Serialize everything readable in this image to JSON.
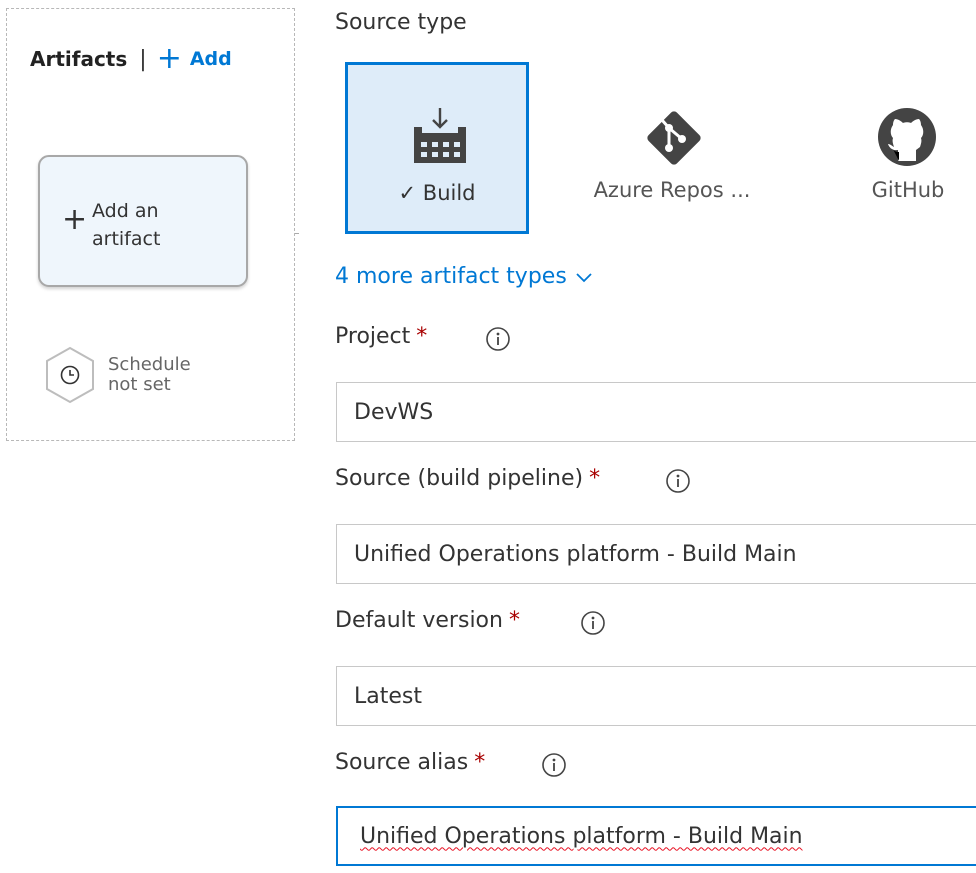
{
  "artifacts": {
    "title": "Artifacts",
    "add_label": "Add",
    "add_card_line1": "Add an",
    "add_card_line2": "artifact",
    "schedule_line1": "Schedule",
    "schedule_line2": "not set"
  },
  "source_type": {
    "label": "Source type",
    "tiles": [
      {
        "label": "Build",
        "icon": "build-icon",
        "selected": true
      },
      {
        "label": "Azure Repos ...",
        "icon": "git-icon",
        "selected": false
      },
      {
        "label": "GitHub",
        "icon": "github-icon",
        "selected": false
      }
    ],
    "more_types": "4 more artifact types"
  },
  "form": {
    "project": {
      "label": "Project",
      "value": "DevWS"
    },
    "source": {
      "label": "Source (build pipeline)",
      "value": "Unified Operations platform - Build Main"
    },
    "default_version": {
      "label": "Default version",
      "value": "Latest"
    },
    "source_alias": {
      "label": "Source alias",
      "value": "Unified Operations platform - Build Main"
    },
    "required_mark": "*"
  },
  "colors": {
    "accent": "#0078d4",
    "selected_tile_bg": "#deecf9",
    "required": "#a80000",
    "card_bg": "#eff6fc"
  }
}
